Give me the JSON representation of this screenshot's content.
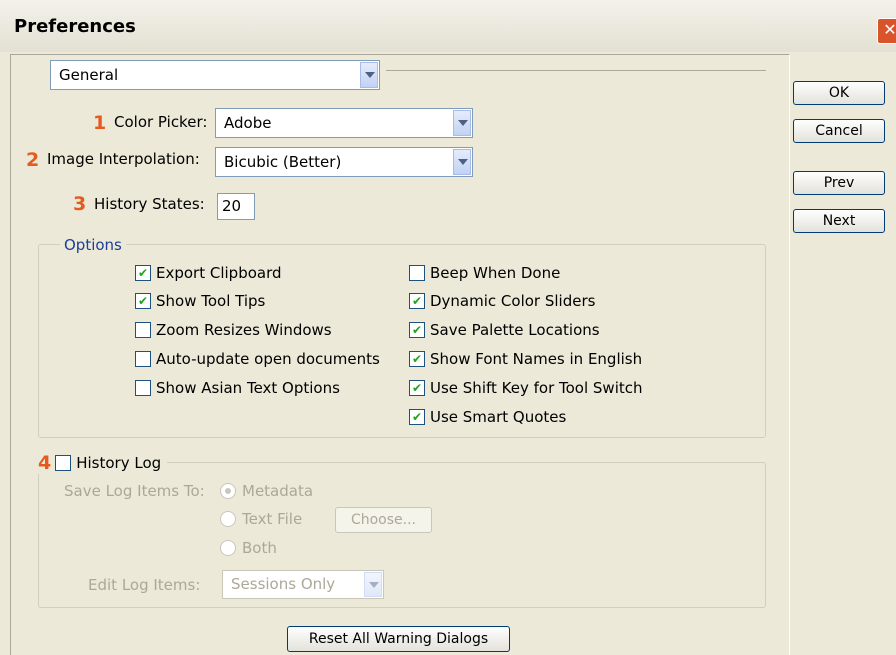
{
  "window": {
    "title": "Preferences"
  },
  "section_select": {
    "value": "General"
  },
  "fields": {
    "color_picker": {
      "marker": "1",
      "label": "Color Picker:",
      "value": "Adobe"
    },
    "image_interpolation": {
      "marker": "2",
      "label": "Image Interpolation:",
      "value": "Bicubic (Better)"
    },
    "history_states": {
      "marker": "3",
      "label": "History States:",
      "value": "20"
    }
  },
  "options": {
    "title": "Options",
    "left": [
      {
        "label": "Export Clipboard",
        "checked": true
      },
      {
        "label": "Show Tool Tips",
        "checked": true
      },
      {
        "label": "Zoom Resizes Windows",
        "checked": false
      },
      {
        "label": "Auto-update open documents",
        "checked": false
      },
      {
        "label": "Show Asian Text Options",
        "checked": false
      }
    ],
    "right": [
      {
        "label": "Beep When Done",
        "checked": false
      },
      {
        "label": "Dynamic Color Sliders",
        "checked": true
      },
      {
        "label": "Save Palette Locations",
        "checked": true
      },
      {
        "label": "Show Font Names in English",
        "checked": true
      },
      {
        "label": "Use Shift Key for Tool Switch",
        "checked": true
      },
      {
        "label": "Use Smart Quotes",
        "checked": true
      }
    ]
  },
  "history_log": {
    "marker": "4",
    "label": "History Log",
    "checked": false,
    "save_to_label": "Save Log Items To:",
    "radios": [
      "Metadata",
      "Text File",
      "Both"
    ],
    "choose_label": "Choose...",
    "edit_label": "Edit Log Items:",
    "edit_value": "Sessions Only"
  },
  "reset_label": "Reset All Warning Dialogs",
  "buttons": {
    "ok": "OK",
    "cancel": "Cancel",
    "prev": "Prev",
    "next": "Next"
  },
  "colors": {
    "marker": "#e55b1f",
    "dialog_bg": "#ece9d8"
  }
}
